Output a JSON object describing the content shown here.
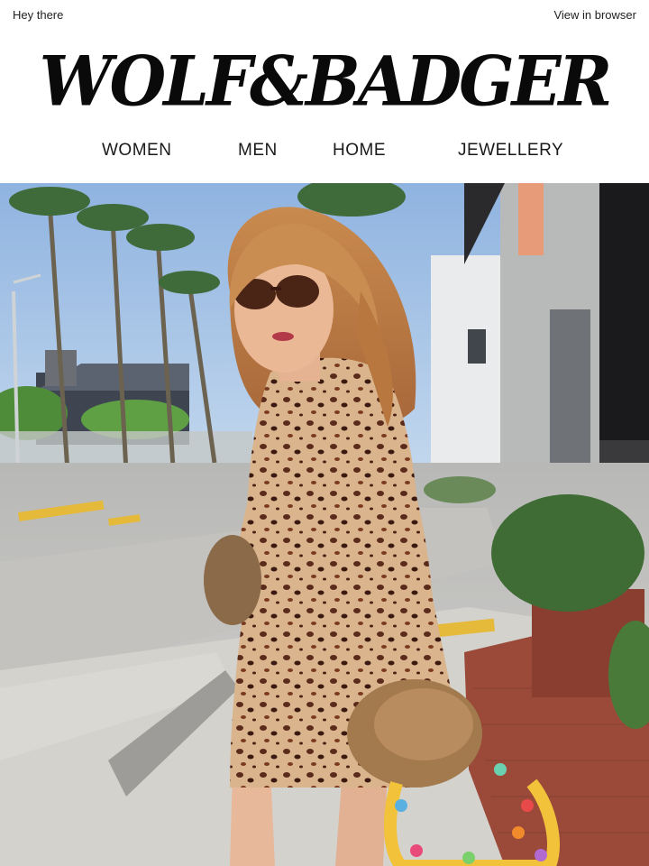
{
  "header": {
    "greeting": "Hey there",
    "view_in_browser": "View in browser",
    "logo_text": "WOLF&BADGER"
  },
  "nav": {
    "items": [
      {
        "label": "WOMEN"
      },
      {
        "label": "MEN"
      },
      {
        "label": "HOME"
      },
      {
        "label": "JEWELLERY"
      }
    ]
  },
  "hero": {
    "image": "hero-photo"
  },
  "colors": {
    "sky": "#a8c4e6",
    "road": "#c9c9c7",
    "dress": "#8a4a2a",
    "brick": "#9b4a3a"
  }
}
